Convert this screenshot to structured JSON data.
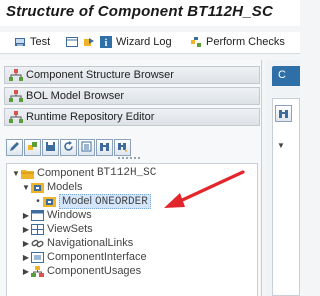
{
  "window": {
    "title": "Structure of Component BT112H_SC"
  },
  "toolbar": {
    "test_label": "Test",
    "wizard_log_label": "Wizard Log",
    "perform_checks_label": "Perform Checks"
  },
  "sections": {
    "component_structure_browser": "Component Structure Browser",
    "bol_model_browser": "BOL Model Browser",
    "runtime_repository_editor": "Runtime Repository Editor"
  },
  "tree": {
    "root_label": "Component",
    "root_name": "BT112H_SC",
    "models_label": "Models",
    "model_label": "Model",
    "model_name": "ONEORDER",
    "windows_label": "Windows",
    "viewsets_label": "ViewSets",
    "navigational_links_label": "NavigationalLinks",
    "component_interface_label": "ComponentInterface",
    "component_usages_label": "ComponentUsages"
  },
  "right_panel": {
    "tab_label": "C"
  },
  "colors": {
    "accent": "#2e6fa8",
    "arrow": "#e3262c",
    "folder": "#f0b429"
  },
  "icons": {
    "test": "test-icon",
    "wizard_log": "info-icon",
    "perform_checks": "checks-icon",
    "component_structure": "hierarchy-icon",
    "folder": "folder-icon"
  }
}
